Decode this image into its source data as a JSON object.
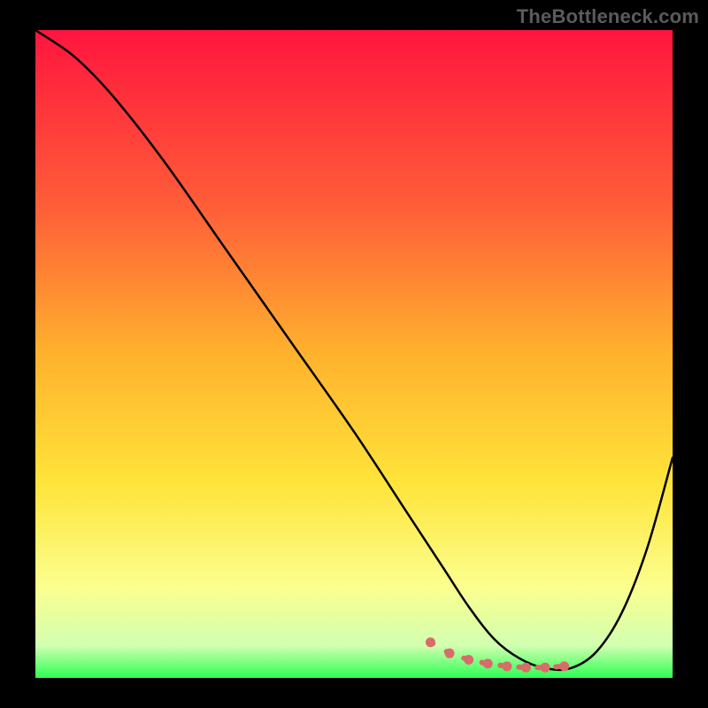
{
  "watermark": "TheBottleneck.com",
  "colors": {
    "frame": "#000000",
    "line": "#000000",
    "marker": "#db6a6a",
    "grad_top": "#ff153e",
    "grad_mid1": "#ff8d2a",
    "grad_mid2": "#ffe43a",
    "grad_low": "#fbff8f",
    "grad_bottom": "#2cff54"
  },
  "chart_data": {
    "type": "line",
    "title": "",
    "xlabel": "",
    "ylabel": "",
    "xlim": [
      0,
      100
    ],
    "ylim": [
      0,
      100
    ],
    "series": [
      {
        "name": "curve",
        "x": [
          0,
          6,
          12,
          20,
          30,
          40,
          50,
          58,
          64,
          68,
          72,
          76,
          80,
          84,
          88,
          92,
          96,
          100
        ],
        "y": [
          100,
          96,
          90,
          80,
          66,
          52,
          38,
          26,
          17,
          11,
          6,
          3,
          1.5,
          1.5,
          4,
          10,
          20,
          34
        ]
      }
    ],
    "markers": {
      "name": "highlight",
      "x": [
        62,
        65,
        68,
        71,
        74,
        77,
        80,
        83
      ],
      "y": [
        5.5,
        3.8,
        2.8,
        2.2,
        1.8,
        1.6,
        1.6,
        1.8
      ]
    }
  }
}
